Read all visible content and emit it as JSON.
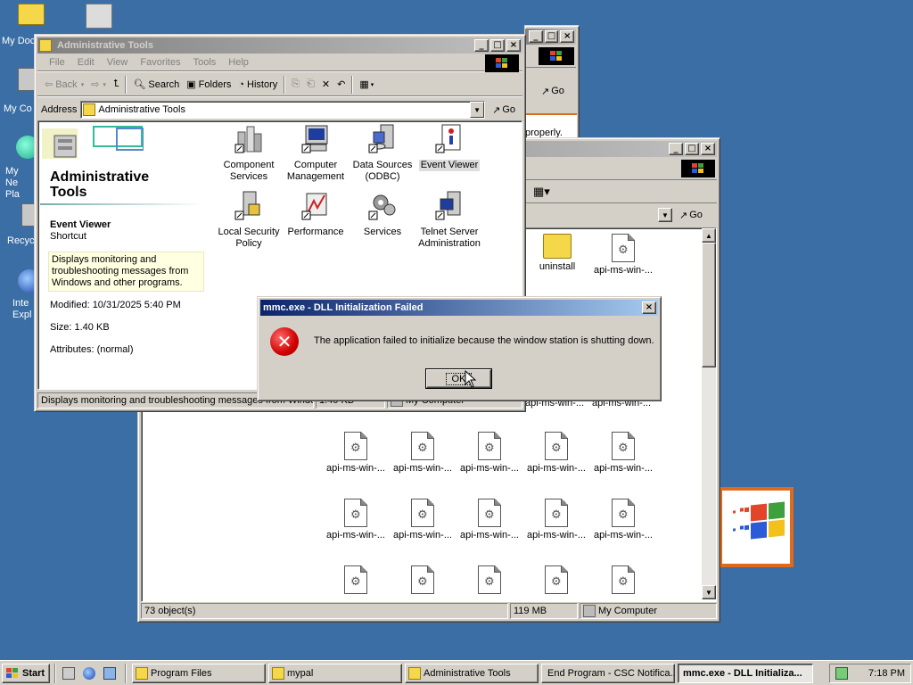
{
  "desktop": {
    "icons": [
      {
        "label": "My Doc"
      },
      {
        "label": "My Co"
      },
      {
        "label": "My Ne Pla"
      },
      {
        "label": "Recyc"
      },
      {
        "label": "Inte Expl"
      }
    ],
    "background_color": "#3a6ea5"
  },
  "back_window": {
    "go_label": "Go",
    "text_fragment": "properly."
  },
  "explorer_window": {
    "go_label": "Go",
    "files_row1": [
      "uninstall",
      "api-ms-win-..."
    ],
    "files_row3": [
      "api-ms-win-...",
      "api-ms-win-...",
      "api-ms-win-...",
      "api-ms-win-...",
      "api-ms-win-..."
    ],
    "files_row4": [
      "api-ms-win-...",
      "api-ms-win-...",
      "api-ms-win-...",
      "api-ms-win-...",
      "api-ms-win-..."
    ],
    "hidden_row_labels": [
      "api-ms-win-...",
      "api-ms-win-..."
    ],
    "status": {
      "objects": "73 object(s)",
      "size": "119 MB",
      "zone": "My Computer"
    }
  },
  "admin_window": {
    "title": "Administrative Tools",
    "menu": [
      "File",
      "Edit",
      "View",
      "Favorites",
      "Tools",
      "Help"
    ],
    "toolbar": {
      "back": "Back",
      "search": "Search",
      "folders": "Folders",
      "history": "History"
    },
    "address_label": "Address",
    "address_value": "Administrative Tools",
    "go_label": "Go",
    "left_pane": {
      "heading": "Administrative Tools",
      "selected_name": "Event Viewer",
      "selected_type": "Shortcut",
      "description": "Displays monitoring and troubleshooting messages from Windows and other programs.",
      "modified": "Modified: 10/31/2025 5:40 PM",
      "size": "Size: 1.40 KB",
      "attributes": "Attributes: (normal)"
    },
    "items": [
      {
        "label": "Component Services",
        "icon": "component-services-icon"
      },
      {
        "label": "Computer Management",
        "icon": "computer-management-icon"
      },
      {
        "label": "Data Sources (ODBC)",
        "icon": "odbc-icon"
      },
      {
        "label": "Event Viewer",
        "icon": "event-viewer-icon"
      },
      {
        "label": "Local Security Policy",
        "icon": "security-policy-icon"
      },
      {
        "label": "Performance",
        "icon": "performance-icon"
      },
      {
        "label": "Services",
        "icon": "services-icon"
      },
      {
        "label": "Telnet Server Administration",
        "icon": "telnet-icon"
      }
    ],
    "status": {
      "text": "Displays monitoring and troubleshooting messages from Window",
      "size": "1.40 KB",
      "zone": "My Computer"
    }
  },
  "dialog": {
    "title": "mmc.exe - DLL Initialization Failed",
    "message": "The application failed to initialize because the window station is shutting down.",
    "ok_label": "OK"
  },
  "taskbar": {
    "start_label": "Start",
    "tasks": [
      {
        "label": "Program Files"
      },
      {
        "label": "mypal"
      },
      {
        "label": "Administrative Tools"
      },
      {
        "label": "End Program - CSC Notifica..."
      },
      {
        "label": "mmc.exe - DLL Initializa..."
      }
    ],
    "clock": "7:18 PM"
  }
}
